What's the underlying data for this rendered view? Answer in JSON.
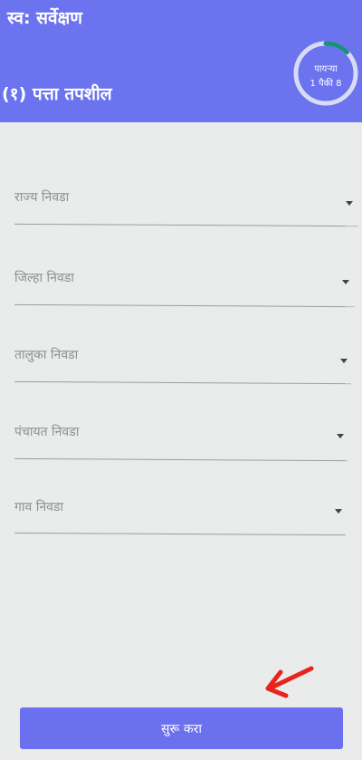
{
  "header": {
    "app_title": "स्व: सर्वेक्षण",
    "section_title": "(१) पत्ता तपशील",
    "progress": {
      "label": "पायऱ्या",
      "step_text": "1 पैकी 8",
      "current": 1,
      "total": 8
    }
  },
  "form": {
    "state_select": {
      "placeholder": "राज्य निवडा"
    },
    "district_select": {
      "placeholder": "जिल्हा निवडा"
    },
    "taluka_select": {
      "placeholder": "तालुका निवडा"
    },
    "panchayat_select": {
      "placeholder": "पंचायत निवडा"
    },
    "village_select": {
      "placeholder": "गाव निवडा"
    }
  },
  "actions": {
    "start_label": "सुरू करा"
  },
  "colors": {
    "header": "#6b73ee",
    "button": "#6a70ee",
    "progress_fill": "#1a8f7a",
    "pointer": "#e8241c"
  }
}
